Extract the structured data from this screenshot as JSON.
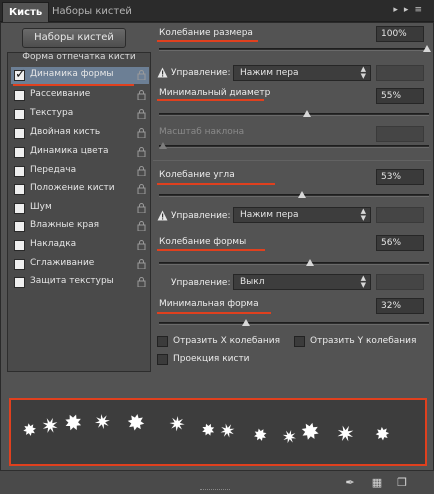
{
  "tabs": [
    {
      "label": "Кисть",
      "active": true
    },
    {
      "label": "Наборы кистей",
      "active": false
    }
  ],
  "titlebar_icons": [
    "collapse-icon",
    "panel-menu-icon"
  ],
  "left": {
    "presets_button": "Наборы кистей",
    "heading": "Форма отпечатка кисти",
    "items": [
      {
        "label": "Динамика формы",
        "checked": true,
        "selected": true
      },
      {
        "label": "Рассеивание",
        "checked": false
      },
      {
        "label": "Текстура",
        "checked": false
      },
      {
        "label": "Двойная кисть",
        "checked": false
      },
      {
        "label": "Динамика цвета",
        "checked": false
      },
      {
        "label": "Передача",
        "checked": false
      },
      {
        "label": "Положение кисти",
        "checked": false
      },
      {
        "label": "Шум",
        "checked": false
      },
      {
        "label": "Влажные края",
        "checked": false
      },
      {
        "label": "Накладка",
        "checked": false
      },
      {
        "label": "Сглаживание",
        "checked": false
      },
      {
        "label": "Защита текстуры",
        "checked": false
      }
    ]
  },
  "right": {
    "size_jitter": {
      "label": "Колебание размера",
      "value": "100%",
      "fraction": 1.0
    },
    "control1": {
      "label": "Управление:",
      "value": "Нажим пера"
    },
    "min_diameter": {
      "label": "Минимальный диаметр",
      "value": "55%",
      "fraction": 0.55
    },
    "tilt_scale": {
      "label": "Масштаб наклона"
    },
    "angle_jitter": {
      "label": "Колебание угла",
      "value": "53%",
      "fraction": 0.53
    },
    "control2": {
      "label": "Управление:",
      "value": "Нажим пера"
    },
    "roundness_jitter": {
      "label": "Колебание формы",
      "value": "56%",
      "fraction": 0.56
    },
    "control3": {
      "label": "Управление:",
      "value": "Выкл"
    },
    "min_roundness": {
      "label": "Минимальная форма",
      "value": "32%",
      "fraction": 0.32
    },
    "flip_x": {
      "label": "Отразить X колебания",
      "checked": false
    },
    "flip_y": {
      "label": "Отразить Y колебания",
      "checked": false
    },
    "brush_projection": {
      "label": "Проекция кисти",
      "checked": false
    }
  },
  "accent_color": "#e0401e",
  "bottom_icons": [
    "toggle-brush-preview-icon",
    "brush-options-icon",
    "new-brush-icon"
  ]
}
